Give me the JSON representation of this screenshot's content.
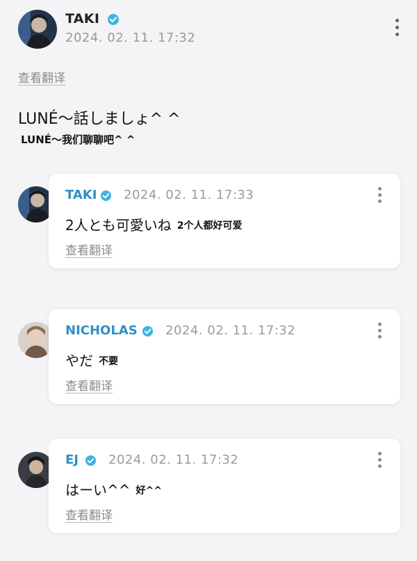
{
  "post": {
    "author": "TAKI",
    "date": "2024. 02. 11. 17:32",
    "translate_label": "查看翻译",
    "text": "LUNÉ～話しましょ^ ^",
    "caption": "LUNÉ～我们聊聊吧^ ^"
  },
  "replies": [
    {
      "author": "TAKI",
      "date": "2024. 02. 11. 17:33",
      "text": "2人とも可愛いね",
      "caption": "2个人都好可爱",
      "translate_label": "查看翻译"
    },
    {
      "author": "NICHOLAS",
      "date": "2024. 02. 11. 17:32",
      "text": "やだ",
      "caption": "不要",
      "translate_label": "查看翻译"
    },
    {
      "author": "EJ",
      "date": "2024. 02. 11. 17:32",
      "text": "はーい^^",
      "caption": "好^^",
      "translate_label": "查看翻译"
    }
  ],
  "icons": {
    "verified": "verified-badge-icon",
    "more": "more-vertical-icon"
  },
  "colors": {
    "accent": "#2f8fc9",
    "verified_badge": "#3fb5e0",
    "secondary_text": "#9a9a9a",
    "background": "#f4f4f6"
  }
}
